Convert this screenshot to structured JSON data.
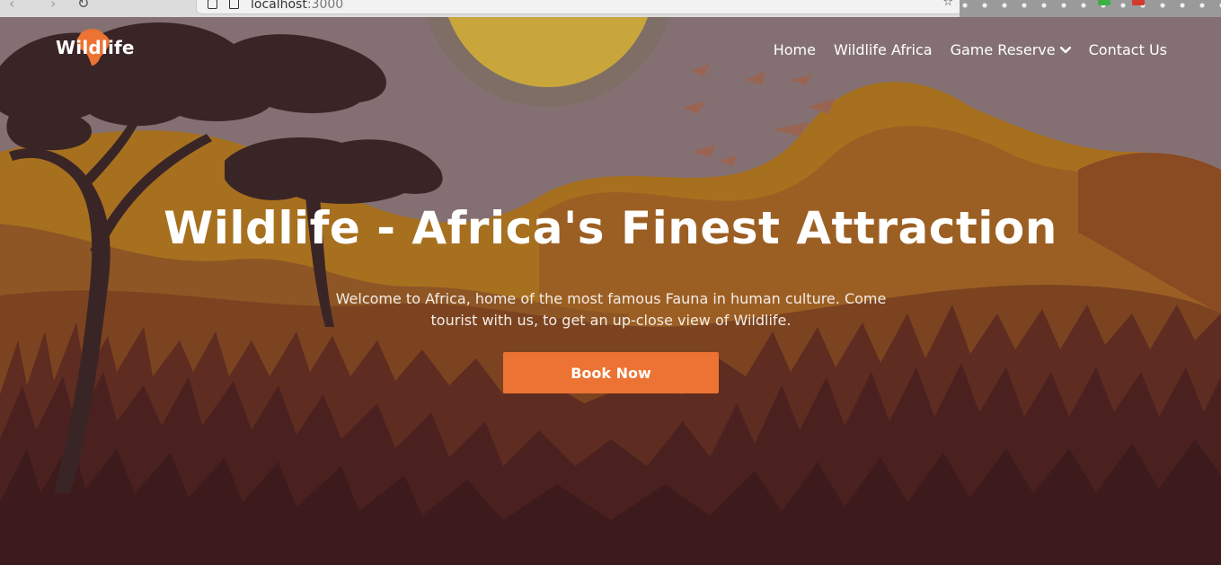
{
  "browser": {
    "url_host": "localhost",
    "url_port": ":3000",
    "back_glyph": "‹",
    "forward_glyph": "›",
    "reload_glyph": "↻",
    "bookmark_glyph": "☆",
    "icons": [
      "back-icon",
      "forward-icon",
      "reload-icon",
      "lock-icon",
      "page-icon",
      "bookmark-icon",
      "extension-icon"
    ]
  },
  "site": {
    "logo": "Wildlife",
    "nav": [
      {
        "label": "Home"
      },
      {
        "label": "Wildlife Africa"
      },
      {
        "label": "Game Reserve",
        "has_dropdown": true
      },
      {
        "label": "Contact Us"
      }
    ]
  },
  "hero": {
    "title": "Wildlife - Africa's Finest Attraction",
    "subtitle": "Welcome to Africa, home of the most famous Fauna in human culture. Come tourist with us, to get an up-close view of Wildlife.",
    "cta": "Book Now"
  },
  "colors": {
    "accent": "#ec7333",
    "sky": "#8a7273",
    "sun": "#c9a53c",
    "ground": "#3b1a1c",
    "tree": "#3a2526"
  }
}
